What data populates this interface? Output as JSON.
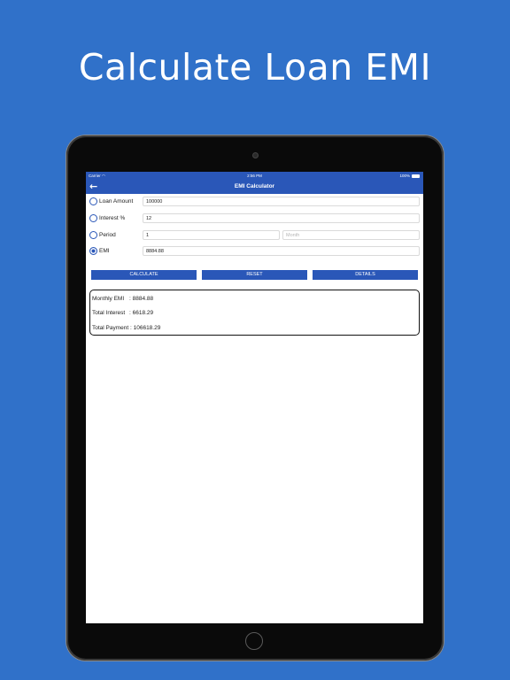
{
  "headline": "Calculate Loan EMI",
  "status": {
    "carrier": "Carrier",
    "time": "2:56 PM",
    "battery": "100%"
  },
  "nav": {
    "back_icon": "arrow-left-icon",
    "title": "EMI Calculator"
  },
  "form": {
    "loan_amount": {
      "label": "Loan Amount",
      "value": "100000"
    },
    "interest": {
      "label": "Interest %",
      "value": "12"
    },
    "period": {
      "label": "Period",
      "value": "1",
      "unit_placeholder": "Month"
    },
    "emi": {
      "label": "EMI",
      "value": "8884.88",
      "selected": true
    }
  },
  "buttons": {
    "calculate": "CALCULATE",
    "reset": "RESET",
    "details": "DETAILS"
  },
  "results": {
    "monthly_emi": {
      "label": "Monthly EMI",
      "value": ": 8884.88"
    },
    "total_interest": {
      "label": "Total Interest",
      "value": ": 6618.29"
    },
    "total_payment": {
      "label": "Total Payment",
      "value": ": 106618.29"
    }
  },
  "colors": {
    "background": "#3071c9",
    "primary": "#2a57b8",
    "text": "#222222"
  }
}
